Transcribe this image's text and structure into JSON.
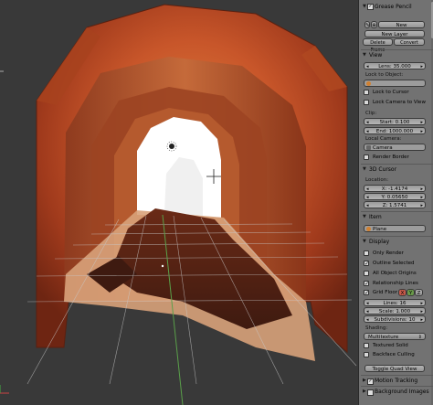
{
  "grease_pencil": {
    "title": "Grease Pencil",
    "new_label": "New",
    "new_layer_label": "New Layer",
    "delete_frame_label": "Delete Frame",
    "convert_label": "Convert"
  },
  "view": {
    "title": "View",
    "lens": "Lens: 35.000",
    "lock_to_object_label": "Lock to Object:",
    "lock_to_cursor": "Lock to Cursor",
    "lock_camera_to_view": "Lock Camera to View",
    "clip_label": "Clip:",
    "clip_start": "Start: 0.100",
    "clip_end": "End: 1000.000",
    "local_camera_label": "Local Camera:",
    "camera_value": "Camera",
    "render_border": "Render Border"
  },
  "cursor3d": {
    "title": "3D Cursor",
    "location_label": "Location:",
    "x": "X: -1.4174",
    "y": "Y: 0.05650",
    "z": "Z: 1.5741"
  },
  "item": {
    "title": "Item",
    "name": "Plane"
  },
  "display": {
    "title": "Display",
    "only_render": "Only Render",
    "outline_selected": "Outline Selected",
    "all_object_origins": "All Object Origins",
    "relationship_lines": "Relationship Lines",
    "grid_floor": "Grid Floor",
    "axis_x": "X",
    "axis_y": "Y",
    "axis_z": "Z",
    "lines": "Lines: 16",
    "scale": "Scale: 1.000",
    "subdivisions": "Subdivisions: 10",
    "shading_label": "Shading:",
    "shading_value": "Multitexture",
    "textured_solid": "Textured Solid",
    "backface_culling": "Backface Culling",
    "toggle_quad_view": "Toggle Quad View"
  },
  "motion_tracking": {
    "title": "Motion Tracking"
  },
  "background_images": {
    "title": "Background Images"
  },
  "colors": {
    "panel_bg": "#727272",
    "viewport_bg": "#393939",
    "tunnel_orange": "#c8562a",
    "tunnel_dark": "#5a2415"
  }
}
